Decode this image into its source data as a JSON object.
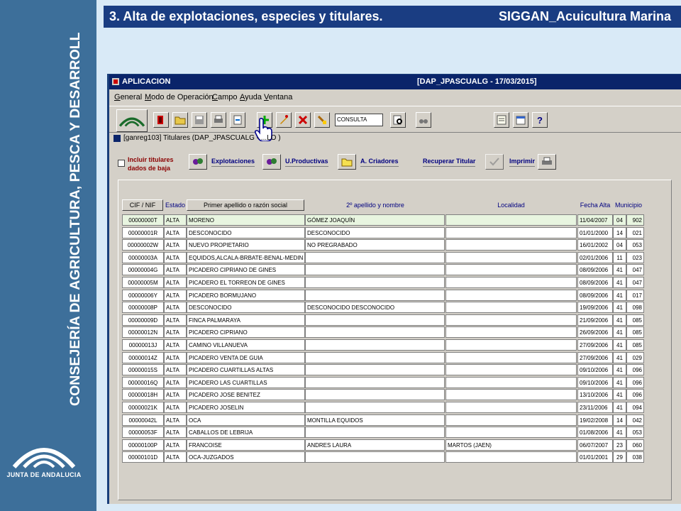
{
  "slide": {
    "title": "3. Alta de explotaciones, especies y titulares.",
    "subtitle": "SIGGAN_Acuicultura Marina",
    "brand_vertical": "CONSEJERÍA DE AGRICULTURA, PESCA Y DESARROLLO RURAL",
    "logo_text": "JUNTA DE ANDALUCIA"
  },
  "app": {
    "title": "APLICACION",
    "status": "[DAP_JPASCUALG - 17/03/2015]",
    "menu": [
      "General",
      "Modo de Operación",
      "Campo",
      "Ayuda",
      "Ventana"
    ],
    "mode_value": "CONSULTA",
    "subwindow_title": "[ganreg103] Titulares (DAP_JPASCUALG - ...LO )"
  },
  "actions": {
    "include_checkbox_label": "Incluir titulares dados de baja",
    "explotaciones": "Explotaciones",
    "uproductivas": "U.Productivas",
    "acriadores": "A. Criadores",
    "recuperar": "Recuperar Titular",
    "imprimir": "Imprimir"
  },
  "grid": {
    "columns": {
      "cif": "CIF / NIF",
      "estado": "Estado",
      "apellido1": "Primer apellido o razón social",
      "apellido2": "2º apellido y nombre",
      "localidad": "Localidad",
      "fecha": "Fecha Alta",
      "municipio": "Municipio"
    },
    "rows": [
      {
        "cif": "00000000T",
        "estado": "ALTA",
        "ap1": "MORENO",
        "ap2": "GÓMEZ JOAQUÍN",
        "loc": "",
        "fecha": "11/04/2007",
        "prov": "04",
        "mun": "902"
      },
      {
        "cif": "00000001R",
        "estado": "ALTA",
        "ap1": "DESCONOCIDO",
        "ap2": "DESCONOCIDO",
        "loc": "",
        "fecha": "01/01/2000",
        "prov": "14",
        "mun": "021"
      },
      {
        "cif": "00000002W",
        "estado": "ALTA",
        "ap1": "NUEVO PROPIETARIO",
        "ap2": "NO PREGRABADO",
        "loc": "",
        "fecha": "16/01/2002",
        "prov": "04",
        "mun": "053"
      },
      {
        "cif": "00000003A",
        "estado": "ALTA",
        "ap1": "EQUIDOS,ALCALA-BRBATE-BENAL-MEDIN",
        "ap2": "",
        "loc": "",
        "fecha": "02/01/2006",
        "prov": "11",
        "mun": "023"
      },
      {
        "cif": "00000004G",
        "estado": "ALTA",
        "ap1": "PICADERO CIPRIANO DE GINES",
        "ap2": "",
        "loc": "",
        "fecha": "08/09/2006",
        "prov": "41",
        "mun": "047"
      },
      {
        "cif": "00000005M",
        "estado": "ALTA",
        "ap1": "PICADERO EL TORREON DE GINES",
        "ap2": "",
        "loc": "",
        "fecha": "08/09/2006",
        "prov": "41",
        "mun": "047"
      },
      {
        "cif": "00000006Y",
        "estado": "ALTA",
        "ap1": "PICADERO BORMUJANO",
        "ap2": "",
        "loc": "",
        "fecha": "08/09/2006",
        "prov": "41",
        "mun": "017"
      },
      {
        "cif": "00000008P",
        "estado": "ALTA",
        "ap1": "DESCONOCIDO",
        "ap2": "DESCONOCIDO DESCONOCIDO",
        "loc": "",
        "fecha": "19/09/2006",
        "prov": "41",
        "mun": "098"
      },
      {
        "cif": "00000009D",
        "estado": "ALTA",
        "ap1": "FINCA PALMARAYA",
        "ap2": "",
        "loc": "",
        "fecha": "21/09/2006",
        "prov": "41",
        "mun": "085"
      },
      {
        "cif": "00000012N",
        "estado": "ALTA",
        "ap1": "PICADERO CIPRIANO",
        "ap2": "",
        "loc": "",
        "fecha": "26/09/2006",
        "prov": "41",
        "mun": "085"
      },
      {
        "cif": "00000013J",
        "estado": "ALTA",
        "ap1": "CAMINO VILLANUEVA",
        "ap2": "",
        "loc": "",
        "fecha": "27/09/2006",
        "prov": "41",
        "mun": "085"
      },
      {
        "cif": "00000014Z",
        "estado": "ALTA",
        "ap1": "PICADERO VENTA DE GUIA",
        "ap2": "",
        "loc": "",
        "fecha": "27/09/2006",
        "prov": "41",
        "mun": "029"
      },
      {
        "cif": "00000015S",
        "estado": "ALTA",
        "ap1": "PICADERO CUARTILLAS ALTAS",
        "ap2": "",
        "loc": "",
        "fecha": "09/10/2006",
        "prov": "41",
        "mun": "096"
      },
      {
        "cif": "00000016Q",
        "estado": "ALTA",
        "ap1": "PICADERO LAS CUARTILLAS",
        "ap2": "",
        "loc": "",
        "fecha": "09/10/2006",
        "prov": "41",
        "mun": "096"
      },
      {
        "cif": "00000018H",
        "estado": "ALTA",
        "ap1": "PICADERO JOSE BENITEZ",
        "ap2": "",
        "loc": "",
        "fecha": "13/10/2006",
        "prov": "41",
        "mun": "096"
      },
      {
        "cif": "00000021K",
        "estado": "ALTA",
        "ap1": "PICADERO JOSELIN",
        "ap2": "",
        "loc": "",
        "fecha": "23/11/2006",
        "prov": "41",
        "mun": "094"
      },
      {
        "cif": "00000042L",
        "estado": "ALTA",
        "ap1": "OCA",
        "ap2": "MONTILLA EQUIDOS",
        "loc": "",
        "fecha": "19/02/2008",
        "prov": "14",
        "mun": "042"
      },
      {
        "cif": "00000053F",
        "estado": "ALTA",
        "ap1": "CABALLOS DE LEBRIJA",
        "ap2": "",
        "loc": "",
        "fecha": "01/08/2006",
        "prov": "41",
        "mun": "053"
      },
      {
        "cif": "00000100P",
        "estado": "ALTA",
        "ap1": "FRANCOISE",
        "ap2": "ANDRES LAURA",
        "loc": "MARTOS (JAEN)",
        "fecha": "06/07/2007",
        "prov": "23",
        "mun": "060"
      },
      {
        "cif": "00000101D",
        "estado": "ALTA",
        "ap1": "OCA-JUZGADOS",
        "ap2": "",
        "loc": "",
        "fecha": "01/01/2001",
        "prov": "29",
        "mun": "038"
      }
    ]
  },
  "icons": {
    "toolbar": [
      "junta-logo-icon",
      "exit-icon",
      "open-folder-icon",
      "save-icon",
      "print-icon",
      "refresh-icon",
      "new-record-icon",
      "edit-icon",
      "delete-icon",
      "clear-icon",
      "query-icon",
      "find-icon",
      "notes-icon",
      "calendar-icon",
      "help-icon"
    ]
  }
}
